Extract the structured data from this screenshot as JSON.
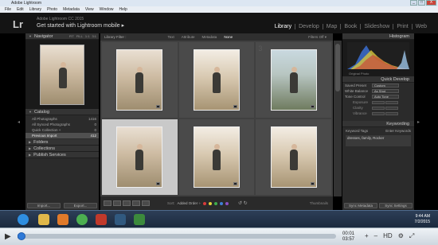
{
  "window": {
    "title": "Adobe Lightroom",
    "buttons": [
      "_",
      "□",
      "X"
    ]
  },
  "menubar": [
    "File",
    "Edit",
    "Library",
    "Photo",
    "Metadata",
    "View",
    "Window",
    "Help"
  ],
  "identity": {
    "logo": "Lr",
    "subtitle": "Adobe Lightroom CC 2015",
    "title": "Get started with Lightroom mobile ▸"
  },
  "modules": [
    {
      "label": "Library",
      "active": true
    },
    {
      "label": "Develop",
      "active": false
    },
    {
      "label": "Map",
      "active": false
    },
    {
      "label": "Book",
      "active": false
    },
    {
      "label": "Slideshow",
      "active": false
    },
    {
      "label": "Print",
      "active": false
    },
    {
      "label": "Web",
      "active": false
    }
  ],
  "left_panel": {
    "navigator_title": "Navigator",
    "navigator_views": [
      "FIT",
      "FILL",
      "1:1",
      "3:1"
    ],
    "catalog_title": "Catalog",
    "catalog_items": [
      {
        "label": "All Photographs",
        "count": "1416",
        "selected": false
      },
      {
        "label": "All Synced Photographs",
        "count": "0",
        "selected": false
      },
      {
        "label": "Quick Collection +",
        "count": "0",
        "selected": false
      },
      {
        "label": "Previous Import",
        "count": "412",
        "selected": true
      }
    ],
    "sections": [
      "Folders",
      "Collections",
      "Publish Services"
    ],
    "import_button": "Import...",
    "export_button": "Export..."
  },
  "filter_bar": {
    "title": "Library Filter :",
    "tabs": [
      {
        "label": "Text",
        "active": false
      },
      {
        "label": "Attribute",
        "active": false
      },
      {
        "label": "Metadata",
        "active": false
      },
      {
        "label": "None",
        "active": true
      }
    ],
    "filters_off": "Filters Off ▾"
  },
  "grid": {
    "cells": [
      {
        "index": "",
        "selected": false,
        "style": "a"
      },
      {
        "index": "",
        "selected": false,
        "style": "b"
      },
      {
        "index": "3",
        "selected": false,
        "style": "c"
      },
      {
        "index": "",
        "selected": true,
        "style": "a"
      },
      {
        "index": "",
        "selected": false,
        "style": "b"
      },
      {
        "index": "",
        "selected": false,
        "style": "b"
      }
    ]
  },
  "toolbar": {
    "sort_label": "Sort:",
    "sort_value": "Added Order ÷",
    "color_labels": [
      "#d83b3b",
      "#e3d23a",
      "#3fae4c",
      "#3f7fd6",
      "#8e4fc4"
    ],
    "thumbnails_label": "Thumbnails"
  },
  "right_panel": {
    "histogram_title": "Histogram",
    "original_photo": "Original Photo",
    "quick_develop_title": "Quick Develop",
    "saved_preset_label": "Saved Preset",
    "saved_preset_value": "Custom",
    "white_balance_label": "White Balance",
    "white_balance_value": "As Shot",
    "tone_control_label": "Tone Control",
    "tone_control_value": "Auto Tone",
    "tone_rows": [
      "Exposure",
      "Clarity",
      "Vibrance"
    ],
    "keywording_title": "Keywording",
    "keyword_tags_label": "Keyword Tags",
    "keyword_tags_value": "Enter Keywords",
    "keywords": "dresses, family, Rocker",
    "sync_metadata_button": "Sync Metadata",
    "sync_settings_button": "Sync Settings"
  },
  "taskbar": {
    "icons": [
      {
        "name": "start-orb-icon",
        "color": "#2f8ee0"
      },
      {
        "name": "explorer-icon",
        "color": "#e0b84a"
      },
      {
        "name": "media-player-icon",
        "color": "#e07a2a"
      },
      {
        "name": "chrome-icon",
        "color": "#4caf50"
      },
      {
        "name": "app-icon",
        "color": "#c0392b"
      },
      {
        "name": "lightroom-icon",
        "color": "#31597f"
      },
      {
        "name": "camtasia-icon",
        "color": "#3c8a3c"
      }
    ],
    "time": "9:44 AM",
    "date": "7/2/2015"
  },
  "player": {
    "elapsed": "00:01",
    "total": "03:57",
    "progress_fraction": 0.0,
    "controls": [
      "+",
      "–",
      "HD",
      "⚙",
      "⤢"
    ]
  }
}
